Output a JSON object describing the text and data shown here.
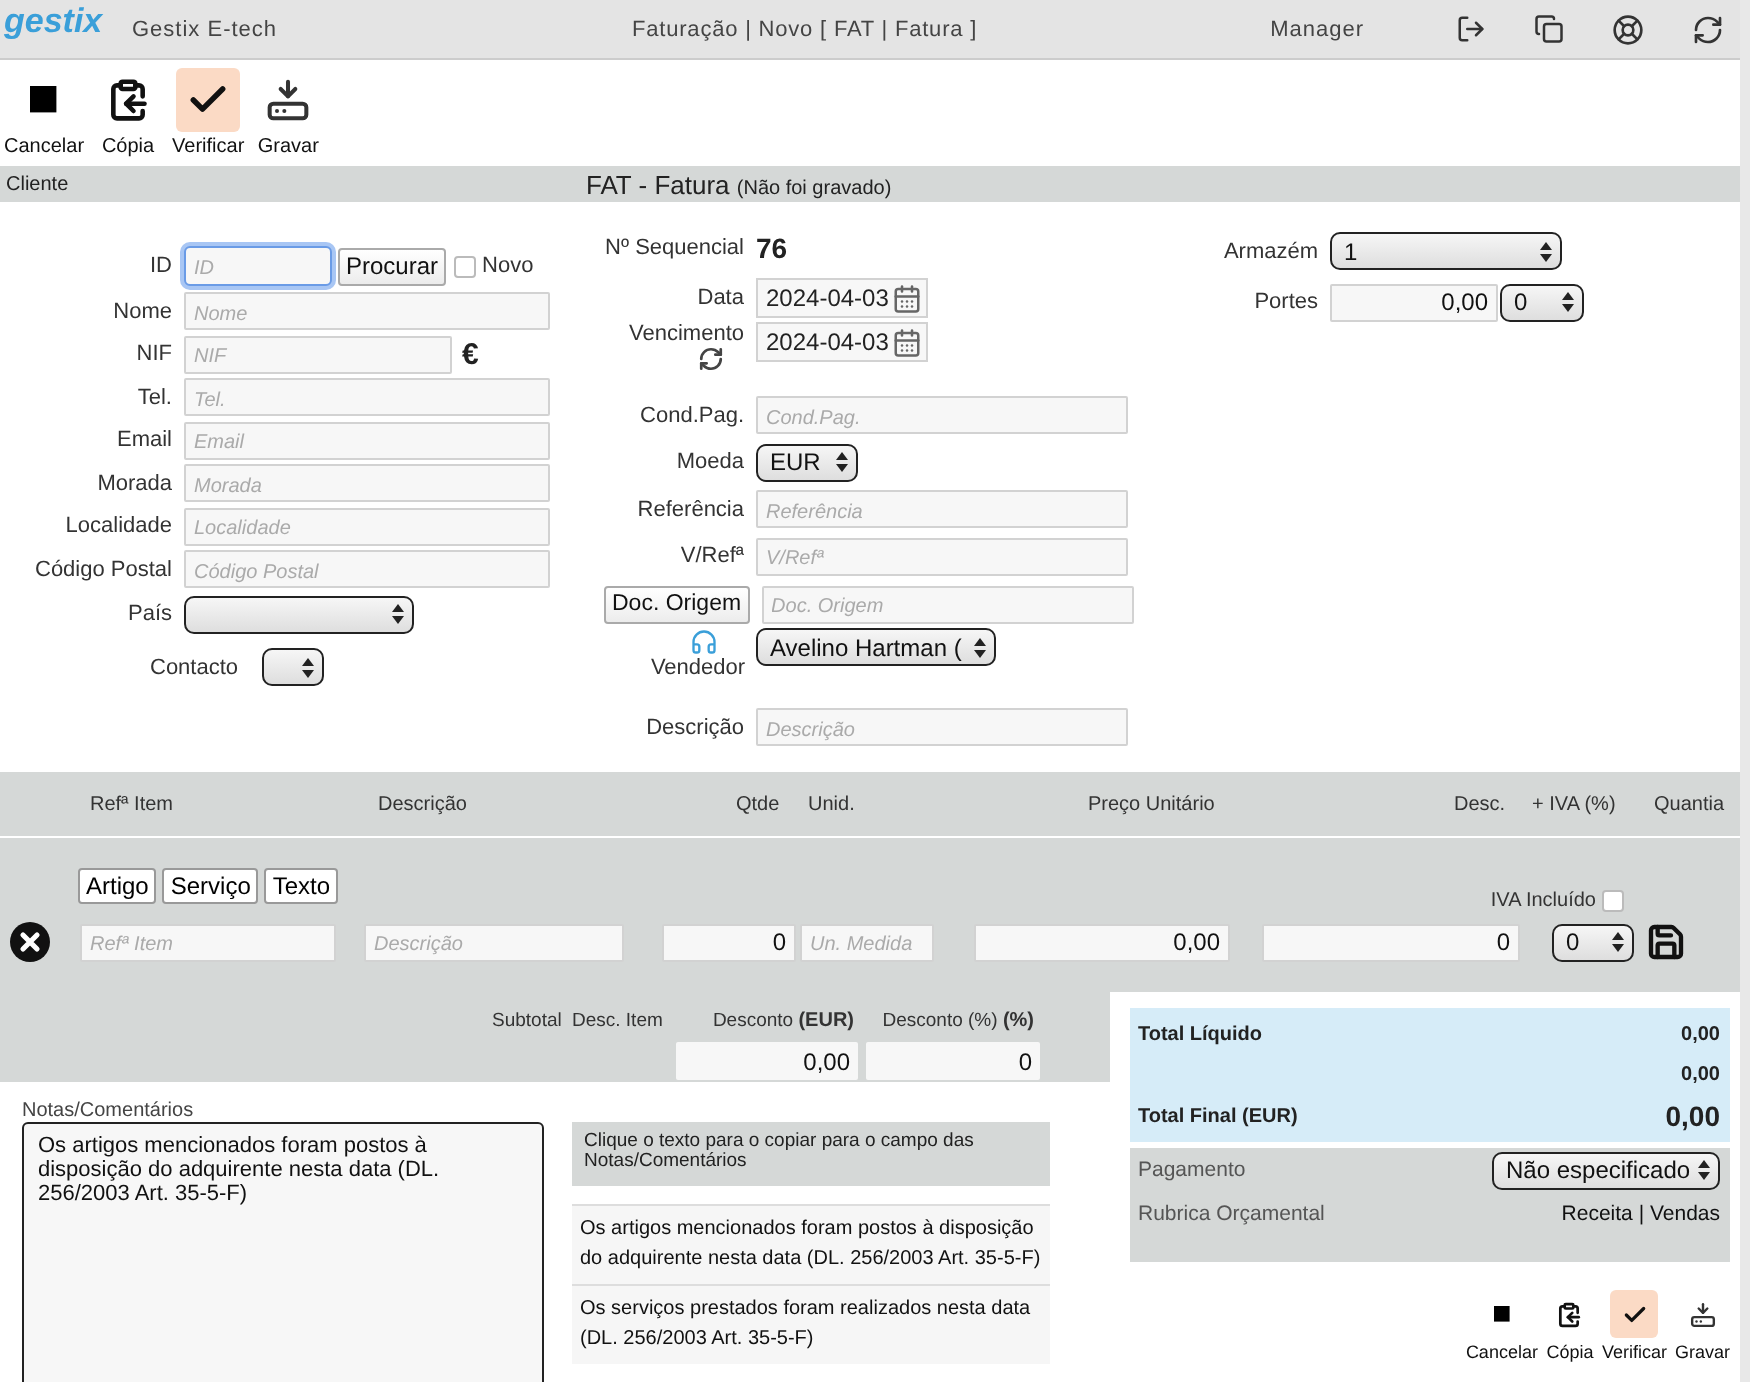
{
  "header": {
    "logo": "gestix",
    "company": "Gestix E-tech",
    "breadcrumb": "Faturação | Novo [ FAT | Fatura ]",
    "user": "Manager"
  },
  "toolbar": [
    {
      "kind": "cancel",
      "label": "Cancelar",
      "selected": false
    },
    {
      "kind": "copy",
      "label": "Cópia",
      "selected": false
    },
    {
      "kind": "verify",
      "label": "Verificar",
      "selected": true
    },
    {
      "kind": "save",
      "label": "Gravar",
      "selected": false
    }
  ],
  "section": {
    "label": "Cliente",
    "title": "FAT - Fatura",
    "status": "(Não foi gravado)"
  },
  "client": [
    {
      "kind": "id",
      "label": "ID",
      "placeholder": "ID",
      "button": "Procurar",
      "checkbox": {
        "label": "Novo",
        "checked": false
      }
    },
    {
      "kind": "text",
      "label": "Nome",
      "placeholder": "Nome"
    },
    {
      "kind": "nif",
      "label": "NIF",
      "placeholder": "NIF",
      "symbol": "€"
    },
    {
      "kind": "text",
      "label": "Tel.",
      "placeholder": "Tel."
    },
    {
      "kind": "text",
      "label": "Email",
      "placeholder": "Email"
    },
    {
      "kind": "text",
      "label": "Morada",
      "placeholder": "Morada"
    },
    {
      "kind": "text",
      "label": "Localidade",
      "placeholder": "Localidade"
    },
    {
      "kind": "text",
      "label": "Código Postal",
      "placeholder": "Código Postal"
    },
    {
      "kind": "select",
      "label": "País"
    },
    {
      "kind": "small_select",
      "label": "Contacto"
    }
  ],
  "document": [
    {
      "kind": "static",
      "label": "Nº Sequencial",
      "value": "76"
    },
    {
      "kind": "date",
      "label": "Data",
      "value": "2024-04-03"
    },
    {
      "kind": "date_refresh",
      "label": "Vencimento",
      "value": "2024-04-03"
    },
    {
      "kind": "text",
      "label": "Cond.Pag.",
      "placeholder": "Cond.Pag."
    },
    {
      "kind": "select",
      "label": "Moeda",
      "value": "EUR"
    },
    {
      "kind": "text",
      "label": "Referência",
      "placeholder": "Referência"
    },
    {
      "kind": "text",
      "label": "V/Refª",
      "placeholder": "V/Refª"
    },
    {
      "kind": "button_text",
      "label": "Doc. Origem",
      "placeholder": "Doc. Origem"
    },
    {
      "kind": "vendor",
      "label": "Vendedor",
      "value": "Avelino Hartman ("
    },
    {
      "kind": "text",
      "label": "Descrição",
      "placeholder": "Descrição"
    }
  ],
  "logistics": [
    {
      "kind": "select",
      "label": "Armazém",
      "value": "1"
    },
    {
      "kind": "amount_select",
      "label": "Portes",
      "value": "0,00",
      "option": "0"
    }
  ],
  "lines": {
    "columns": [
      "Refª Item",
      "Descrição",
      "Qtde",
      "Unid.",
      "Preço Unitário",
      "Desc.",
      "+ IVA (%)",
      "Quantia"
    ],
    "types": [
      "Artigo",
      "Serviço",
      "Texto"
    ],
    "iva_included": {
      "label": "IVA Incluído",
      "checked": false
    },
    "entry": {
      "ref_placeholder": "Refª Item",
      "description_placeholder": "Descrição",
      "quantity": "0",
      "unit_placeholder": "Un. Medida",
      "price": "0,00",
      "discount": "0",
      "vat": "0"
    }
  },
  "discounts": {
    "labels": [
      "Subtotal",
      "Desc. Item",
      "Desconto  **(EUR)**",
      "Desconto (%)  **(%)**"
    ],
    "amount": "0,00",
    "percent": "0"
  },
  "notes": {
    "label": "Notas/Comentários",
    "value": "Os artigos mencionados foram postos à disposição do adquirente nesta data (DL. 256/2003 Art. 35-5-F)",
    "hint": "Clique o texto para o copiar para o campo das Notas/Comentários",
    "suggestions": [
      "Os artigos mencionados foram postos à disposição do adquirente nesta data (DL. 256/2003 Art. 35-5-F)",
      "Os serviços prestados foram realizados nesta data (DL. 256/2003 Art. 35-5-F)"
    ]
  },
  "totals": [
    {
      "kind": "normal",
      "label": "Total Líquido",
      "value": "0,00"
    },
    {
      "kind": "normal",
      "value": "0,00"
    },
    {
      "kind": "final",
      "label": "Total Final (EUR)",
      "value": "0,00"
    }
  ],
  "payment": {
    "label": "Pagamento",
    "value": "Não especificado"
  },
  "budget": {
    "label": "Rubrica Orçamental",
    "value": "Receita | Vendas"
  },
  "bottom_toolbar": [
    {
      "kind": "cancel",
      "label": "Cancelar",
      "selected": false
    },
    {
      "kind": "copy",
      "label": "Cópia",
      "selected": false
    },
    {
      "kind": "verify",
      "label": "Verificar",
      "selected": true
    },
    {
      "kind": "save",
      "label": "Gravar",
      "selected": false
    }
  ]
}
